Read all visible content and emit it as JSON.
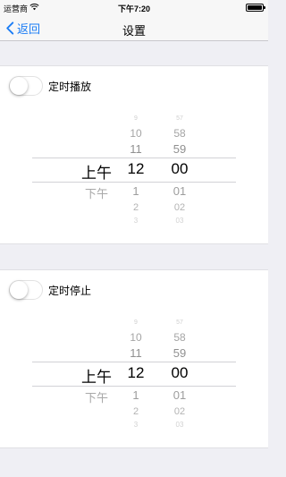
{
  "status_bar": {
    "carrier": "运营商",
    "time": "下午7:20",
    "wifi_icon": "wifi-icon",
    "battery_icon": "battery-icon"
  },
  "nav_bar": {
    "back_label": "返回",
    "back_icon": "chevron-left-icon",
    "title": "设置"
  },
  "accent_color": "#1a7cf5",
  "sections": [
    {
      "toggle_label": "定时播放",
      "toggle_on": false,
      "picker": {
        "ampm": [
          "上午",
          "下午"
        ],
        "hours": [
          "9",
          "10",
          "11",
          "12",
          "1",
          "2",
          "3"
        ],
        "minutes": [
          "57",
          "58",
          "59",
          "00",
          "01",
          "02",
          "03"
        ],
        "selected": {
          "ampm": "上午",
          "hour": "12",
          "minute": "00"
        }
      }
    },
    {
      "toggle_label": "定时停止",
      "toggle_on": false,
      "picker": {
        "ampm": [
          "上午",
          "下午"
        ],
        "hours": [
          "9",
          "10",
          "11",
          "12",
          "1",
          "2",
          "3"
        ],
        "minutes": [
          "57",
          "58",
          "59",
          "00",
          "01",
          "02",
          "03"
        ],
        "selected": {
          "ampm": "上午",
          "hour": "12",
          "minute": "00"
        }
      }
    }
  ]
}
